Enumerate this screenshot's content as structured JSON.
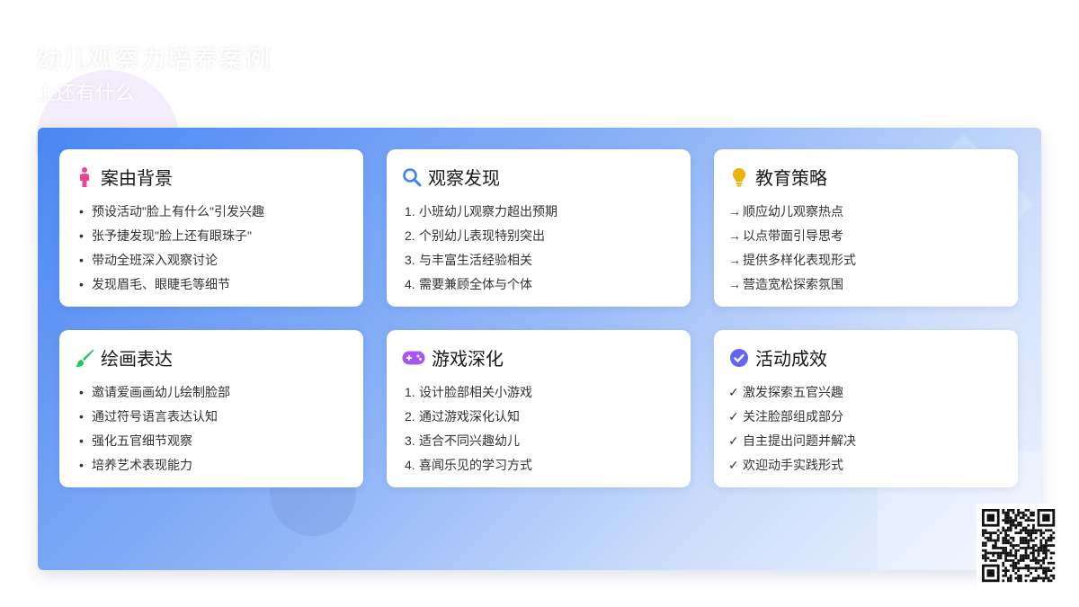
{
  "header": {
    "title": "幼儿观察力培养案例",
    "subtitle": "上还有什么"
  },
  "cards": [
    {
      "title": "案由背景",
      "icon": "child-icon",
      "list_style": "bullet",
      "items": [
        "预设活动\"脸上有什么\"引发兴趣",
        "张予捷发现\"脸上还有眼珠子\"",
        "带动全班深入观察讨论",
        "发现眉毛、眼睫毛等细节"
      ]
    },
    {
      "title": "观察发现",
      "icon": "search-icon",
      "list_style": "number",
      "items": [
        "小班幼儿观察力超出预期",
        "个别幼儿表现特别突出",
        "与丰富生活经验相关",
        "需要兼顾全体与个体"
      ]
    },
    {
      "title": "教育策略",
      "icon": "lightbulb-icon",
      "list_style": "arrow",
      "items": [
        "顺应幼儿观察热点",
        "以点带面引导思考",
        "提供多样化表现形式",
        "营造宽松探索氛围"
      ]
    },
    {
      "title": "绘画表达",
      "icon": "paintbrush-icon",
      "list_style": "bullet",
      "items": [
        "邀请爱画画幼儿绘制脸部",
        "通过符号语言表达认知",
        "强化五官细节观察",
        "培养艺术表现能力"
      ]
    },
    {
      "title": "游戏深化",
      "icon": "gamepad-icon",
      "list_style": "number",
      "items": [
        "设计脸部相关小游戏",
        "通过游戏深化认知",
        "适合不同兴趣幼儿",
        "喜闻乐见的学习方式"
      ]
    },
    {
      "title": "活动成效",
      "icon": "check-circle-icon",
      "list_style": "check",
      "items": [
        "激发探索五官兴趣",
        "关注脸部组成部分",
        "自主提出问题并解决",
        "欢迎动手实践形式"
      ]
    }
  ],
  "markers": {
    "bullet": "•",
    "arrow": "→",
    "check": "✓",
    "numbers": [
      "1.",
      "2.",
      "3.",
      "4."
    ]
  },
  "colors": {
    "child-icon": "#e8459a",
    "search-icon": "#3b82f6",
    "lightbulb-icon": "#eab308",
    "paintbrush-icon": "#22c55e",
    "gamepad-icon": "#a855f7",
    "check-circle-icon": "#6366f1"
  }
}
